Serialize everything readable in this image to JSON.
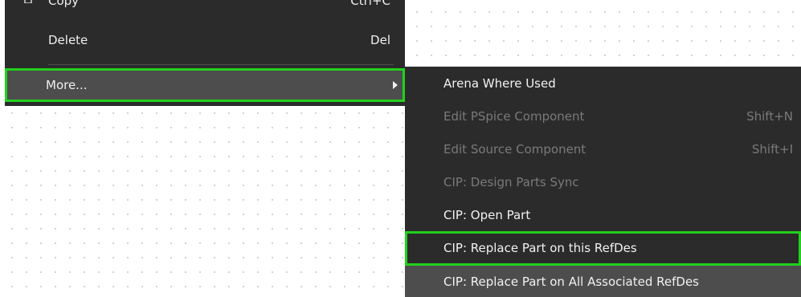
{
  "context_menu": {
    "items": [
      {
        "label": "Copy",
        "shortcut": "Ctrl+C"
      },
      {
        "label": "Delete",
        "shortcut": "Del"
      },
      {
        "label": "More..."
      }
    ]
  },
  "submenu": {
    "items": [
      {
        "label": "Arena Where Used",
        "shortcut": "",
        "enabled": true
      },
      {
        "label": "Edit PSpice Component",
        "shortcut": "Shift+N",
        "enabled": false
      },
      {
        "label": "Edit Source Component",
        "shortcut": "Shift+I",
        "enabled": false
      },
      {
        "label": "CIP: Design Parts Sync",
        "shortcut": "",
        "enabled": false
      },
      {
        "label": "CIP: Open Part",
        "shortcut": "",
        "enabled": true
      },
      {
        "label": "CIP: Replace Part on this RefDes",
        "shortcut": "",
        "enabled": true
      },
      {
        "label": "CIP: Replace Part on All Associated RefDes",
        "shortcut": "",
        "enabled": true
      }
    ]
  },
  "colors": {
    "menu_background": "#2b2b2b",
    "hover_background": "#4d4d4d",
    "highlight_outline": "#22d11c",
    "text_enabled": "#f2f2f2",
    "text_disabled": "#7a7a7a"
  },
  "icons": {
    "copy": "copy-icon",
    "submenu_arrow": "chevron-right-icon"
  }
}
